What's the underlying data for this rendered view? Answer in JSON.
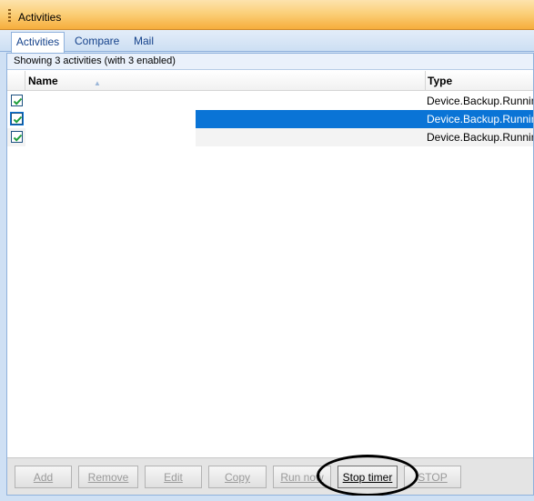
{
  "window": {
    "title": "Activities"
  },
  "tabs": [
    {
      "label": "Activities",
      "active": true
    },
    {
      "label": "Compare",
      "active": false
    },
    {
      "label": "Mail",
      "active": false
    }
  ],
  "status_text": "Showing 3 activities (with 3 enabled)",
  "columns": {
    "name": "Name",
    "type": "Type"
  },
  "rows": [
    {
      "name": "",
      "type": "Device.Backup.Running",
      "enabled": true,
      "selected": false
    },
    {
      "name": "",
      "type": "Device.Backup.Running",
      "enabled": true,
      "selected": true
    },
    {
      "name": "",
      "type": "Device.Backup.Running",
      "enabled": true,
      "selected": false
    }
  ],
  "buttons": {
    "add": "Add",
    "remove": "Remove",
    "edit": "Edit",
    "copy": "Copy",
    "run_now": "Run now",
    "stop_timer": "Stop timer",
    "stop": "STOP"
  },
  "colors": {
    "title_bar": "#f6ad3c",
    "selection": "#0a74d6",
    "highlight_circle": "#000000"
  }
}
